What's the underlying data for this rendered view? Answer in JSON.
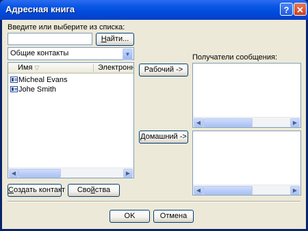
{
  "window": {
    "title": "Адресная книга",
    "help_label": "?",
    "close_label": "✕"
  },
  "search": {
    "prompt": "Введите или выберите из списка:",
    "value": "",
    "find_prefix": "",
    "find_key": "Н",
    "find_rest": "айти..."
  },
  "book_select": {
    "value": "Общие контакты",
    "arrow": "▼"
  },
  "contacts": {
    "columns": [
      "Имя",
      "Электронная"
    ],
    "sort_indicator": "▽",
    "rows": [
      "Micheal Evans",
      "Johe Smith"
    ]
  },
  "buttons": {
    "work": "Рабочий ->",
    "home": "Домашний ->",
    "create_contact_key": "С",
    "create_contact_rest": "оздать контакт",
    "properties_prefix": "Сво",
    "properties_key": "й",
    "properties_rest": "ства",
    "ok": "OK",
    "cancel": "Отмена"
  },
  "recipients": {
    "label": "Получатели сообщения:"
  },
  "scroll": {
    "left": "◀",
    "right": "▶"
  }
}
